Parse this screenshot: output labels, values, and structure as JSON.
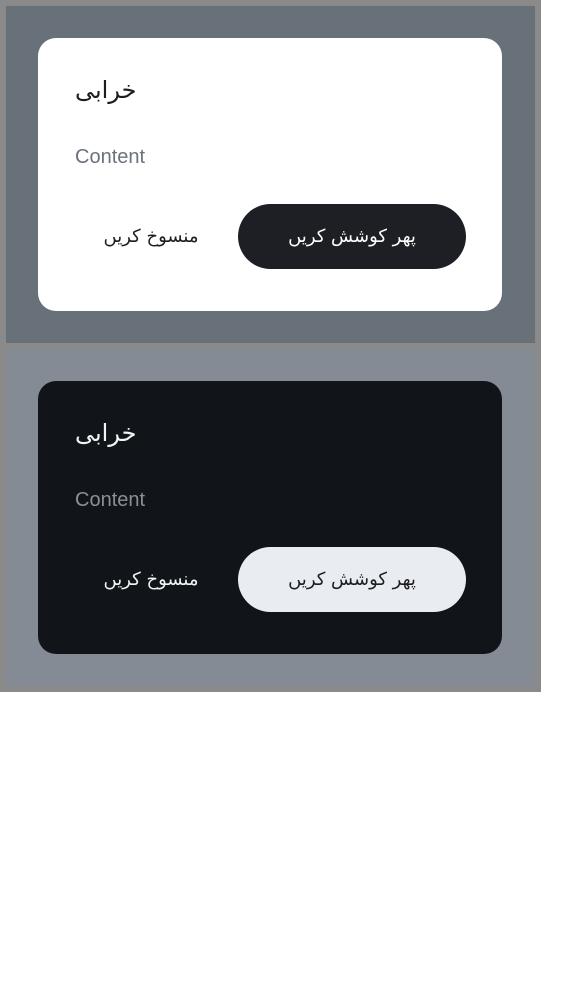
{
  "dialogs": [
    {
      "theme": "light",
      "title": "خرابی",
      "content": "Content",
      "confirm_label": "پھر کوشش کریں",
      "cancel_label": "منسوخ کریں"
    },
    {
      "theme": "dark",
      "title": "خرابی",
      "content": "Content",
      "confirm_label": "پھر کوشش کریں",
      "cancel_label": "منسوخ کریں"
    }
  ],
  "colors": {
    "light_scrim": "#687079",
    "dark_scrim": "#858b94",
    "dark_surface": "#111418",
    "light_primary": "#1e1f24",
    "dark_primary": "#e9ecf1"
  }
}
